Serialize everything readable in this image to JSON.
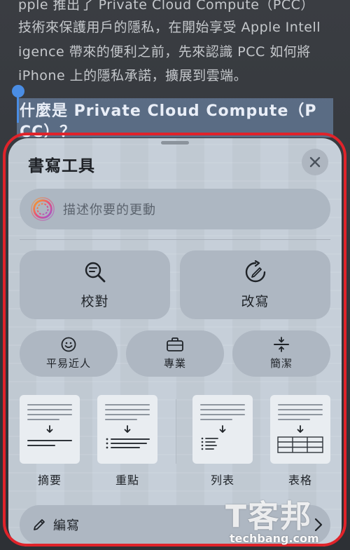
{
  "article": {
    "lines": [
      "pple 推出了 Private Cloud Compute（PCC）",
      "技術來保護用戶的隱私，在開始享受 Apple Intell",
      "igence 帶來的便利之前，先來認識 PCC 如何將",
      "iPhone 上的隱私承諾，擴展到雲端。"
    ],
    "heading": "什麼是 Private Cloud Compute（P",
    "heading_cont": "CC）？"
  },
  "panel": {
    "title": "書寫工具",
    "prompt_placeholder": "描述你要的更動",
    "actions": {
      "proofread": "校對",
      "rewrite": "改寫"
    },
    "tones": {
      "friendly": "平易近人",
      "professional": "專業",
      "concise": "簡潔"
    },
    "formats": {
      "summary": "摘要",
      "key_points": "重點",
      "list": "列表",
      "table": "表格"
    },
    "compose": "編寫"
  },
  "watermark": {
    "main": "T客邦",
    "sub": "techbang.com"
  },
  "colors": {
    "highlight_frame": "#e0232a",
    "panel_bg": "#c6cfd9",
    "selection": "#4a8de4"
  }
}
